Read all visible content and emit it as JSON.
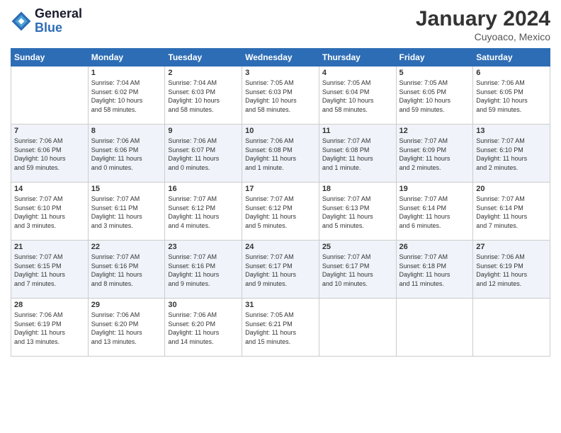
{
  "header": {
    "logo_line1": "General",
    "logo_line2": "Blue",
    "title": "January 2024",
    "subtitle": "Cuyoaco, Mexico"
  },
  "weekdays": [
    "Sunday",
    "Monday",
    "Tuesday",
    "Wednesday",
    "Thursday",
    "Friday",
    "Saturday"
  ],
  "weeks": [
    [
      {
        "day": "",
        "info": ""
      },
      {
        "day": "1",
        "info": "Sunrise: 7:04 AM\nSunset: 6:02 PM\nDaylight: 10 hours\nand 58 minutes."
      },
      {
        "day": "2",
        "info": "Sunrise: 7:04 AM\nSunset: 6:03 PM\nDaylight: 10 hours\nand 58 minutes."
      },
      {
        "day": "3",
        "info": "Sunrise: 7:05 AM\nSunset: 6:03 PM\nDaylight: 10 hours\nand 58 minutes."
      },
      {
        "day": "4",
        "info": "Sunrise: 7:05 AM\nSunset: 6:04 PM\nDaylight: 10 hours\nand 58 minutes."
      },
      {
        "day": "5",
        "info": "Sunrise: 7:05 AM\nSunset: 6:05 PM\nDaylight: 10 hours\nand 59 minutes."
      },
      {
        "day": "6",
        "info": "Sunrise: 7:06 AM\nSunset: 6:05 PM\nDaylight: 10 hours\nand 59 minutes."
      }
    ],
    [
      {
        "day": "7",
        "info": "Sunrise: 7:06 AM\nSunset: 6:06 PM\nDaylight: 10 hours\nand 59 minutes."
      },
      {
        "day": "8",
        "info": "Sunrise: 7:06 AM\nSunset: 6:06 PM\nDaylight: 11 hours\nand 0 minutes."
      },
      {
        "day": "9",
        "info": "Sunrise: 7:06 AM\nSunset: 6:07 PM\nDaylight: 11 hours\nand 0 minutes."
      },
      {
        "day": "10",
        "info": "Sunrise: 7:06 AM\nSunset: 6:08 PM\nDaylight: 11 hours\nand 1 minute."
      },
      {
        "day": "11",
        "info": "Sunrise: 7:07 AM\nSunset: 6:08 PM\nDaylight: 11 hours\nand 1 minute."
      },
      {
        "day": "12",
        "info": "Sunrise: 7:07 AM\nSunset: 6:09 PM\nDaylight: 11 hours\nand 2 minutes."
      },
      {
        "day": "13",
        "info": "Sunrise: 7:07 AM\nSunset: 6:10 PM\nDaylight: 11 hours\nand 2 minutes."
      }
    ],
    [
      {
        "day": "14",
        "info": "Sunrise: 7:07 AM\nSunset: 6:10 PM\nDaylight: 11 hours\nand 3 minutes."
      },
      {
        "day": "15",
        "info": "Sunrise: 7:07 AM\nSunset: 6:11 PM\nDaylight: 11 hours\nand 3 minutes."
      },
      {
        "day": "16",
        "info": "Sunrise: 7:07 AM\nSunset: 6:12 PM\nDaylight: 11 hours\nand 4 minutes."
      },
      {
        "day": "17",
        "info": "Sunrise: 7:07 AM\nSunset: 6:12 PM\nDaylight: 11 hours\nand 5 minutes."
      },
      {
        "day": "18",
        "info": "Sunrise: 7:07 AM\nSunset: 6:13 PM\nDaylight: 11 hours\nand 5 minutes."
      },
      {
        "day": "19",
        "info": "Sunrise: 7:07 AM\nSunset: 6:14 PM\nDaylight: 11 hours\nand 6 minutes."
      },
      {
        "day": "20",
        "info": "Sunrise: 7:07 AM\nSunset: 6:14 PM\nDaylight: 11 hours\nand 7 minutes."
      }
    ],
    [
      {
        "day": "21",
        "info": "Sunrise: 7:07 AM\nSunset: 6:15 PM\nDaylight: 11 hours\nand 7 minutes."
      },
      {
        "day": "22",
        "info": "Sunrise: 7:07 AM\nSunset: 6:16 PM\nDaylight: 11 hours\nand 8 minutes."
      },
      {
        "day": "23",
        "info": "Sunrise: 7:07 AM\nSunset: 6:16 PM\nDaylight: 11 hours\nand 9 minutes."
      },
      {
        "day": "24",
        "info": "Sunrise: 7:07 AM\nSunset: 6:17 PM\nDaylight: 11 hours\nand 9 minutes."
      },
      {
        "day": "25",
        "info": "Sunrise: 7:07 AM\nSunset: 6:17 PM\nDaylight: 11 hours\nand 10 minutes."
      },
      {
        "day": "26",
        "info": "Sunrise: 7:07 AM\nSunset: 6:18 PM\nDaylight: 11 hours\nand 11 minutes."
      },
      {
        "day": "27",
        "info": "Sunrise: 7:06 AM\nSunset: 6:19 PM\nDaylight: 11 hours\nand 12 minutes."
      }
    ],
    [
      {
        "day": "28",
        "info": "Sunrise: 7:06 AM\nSunset: 6:19 PM\nDaylight: 11 hours\nand 13 minutes."
      },
      {
        "day": "29",
        "info": "Sunrise: 7:06 AM\nSunset: 6:20 PM\nDaylight: 11 hours\nand 13 minutes."
      },
      {
        "day": "30",
        "info": "Sunrise: 7:06 AM\nSunset: 6:20 PM\nDaylight: 11 hours\nand 14 minutes."
      },
      {
        "day": "31",
        "info": "Sunrise: 7:05 AM\nSunset: 6:21 PM\nDaylight: 11 hours\nand 15 minutes."
      },
      {
        "day": "",
        "info": ""
      },
      {
        "day": "",
        "info": ""
      },
      {
        "day": "",
        "info": ""
      }
    ]
  ]
}
